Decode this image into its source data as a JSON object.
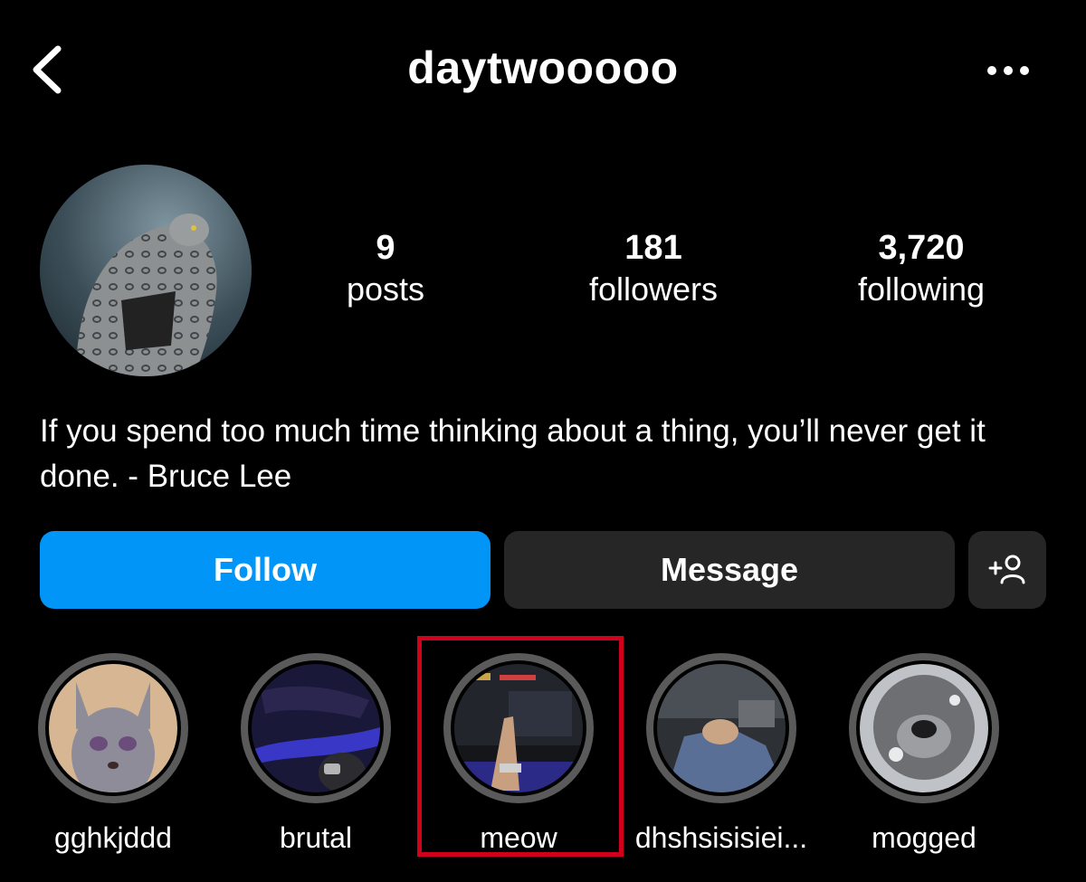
{
  "header": {
    "back_icon": "chevron-left-icon",
    "username": "daytwooooo",
    "more_icon": "more-horizontal-icon"
  },
  "profile": {
    "avatar_description": "snow leopard avatar",
    "stats": [
      {
        "value": "9",
        "label": "posts"
      },
      {
        "value": "181",
        "label": "followers"
      },
      {
        "value": "3,720",
        "label": "following"
      }
    ],
    "bio": "If you spend too much time thinking about a thing, you’ll never get it done. - Bruce Lee"
  },
  "actions": {
    "follow_label": "Follow",
    "message_label": "Message",
    "add_user_icon": "add-user-icon",
    "follow_color": "#0095f6",
    "secondary_color": "#262626"
  },
  "highlights": [
    {
      "label": "gghkjddd"
    },
    {
      "label": "brutal"
    },
    {
      "label": "meow"
    },
    {
      "label": "dhshsisisiei..."
    },
    {
      "label": "mogged"
    }
  ],
  "annotation": {
    "color": "#d0021b",
    "target": "meow"
  }
}
